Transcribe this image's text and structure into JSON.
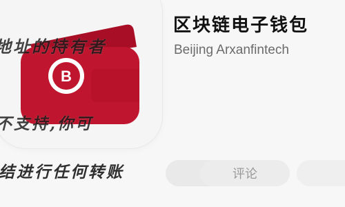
{
  "app": {
    "name": "区块链电子钱包",
    "developer": "Beijing Arxanfintech",
    "icon": "wallet-app-icon",
    "icon_symbol": "B",
    "accent_color": "#c0152e",
    "accent_dark": "#a80e25"
  },
  "buttons": {
    "review_label": "评论"
  },
  "captions": {
    "line1": "地址的持有者",
    "line2": "不支持,你可",
    "line3": "结进行任何转账"
  }
}
